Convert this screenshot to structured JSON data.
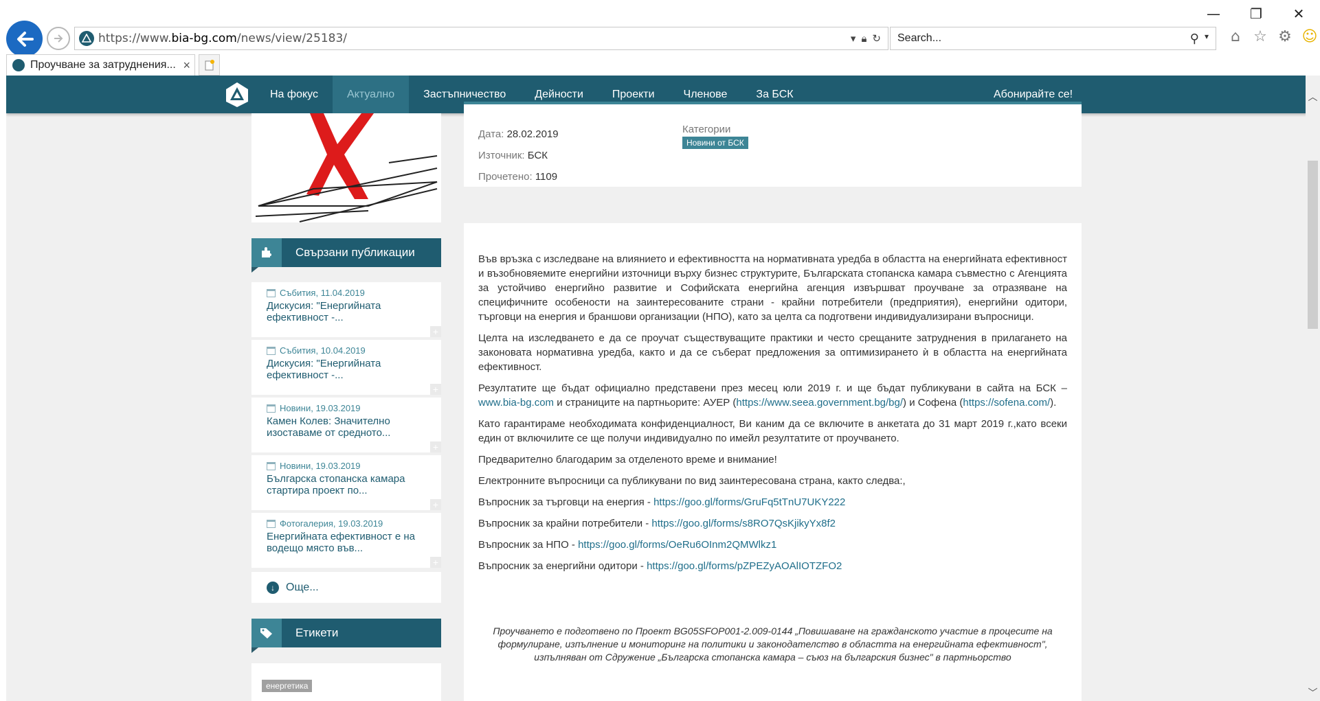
{
  "browser": {
    "url_prefix": "https://www.",
    "url_host": "bia-bg.com",
    "url_path": "/news/view/25183/",
    "search_placeholder": "Search...",
    "tab_title": "Проучване за затруднения...",
    "tab_close": "×",
    "win_minimize": "—",
    "win_restore": "❐",
    "win_close": "✕"
  },
  "nav": {
    "items": [
      "На фокус",
      "Актуално",
      "Застъпничество",
      "Дейности",
      "Проекти",
      "Членове",
      "За БСК"
    ],
    "active_index": 1,
    "subscribe": "Абонирайте се!"
  },
  "sidebar": {
    "related_title": "Свързани публикации",
    "publications": [
      {
        "meta": "Събития, 11.04.2019",
        "title": "Дискусия: \"Енергийната ефективност -..."
      },
      {
        "meta": "Събития, 10.04.2019",
        "title": "Дискусия: \"Енергийната ефективност -..."
      },
      {
        "meta": "Новини, 19.03.2019",
        "title": "Камен Колев: Значително изоставаме от средното..."
      },
      {
        "meta": "Новини, 19.03.2019",
        "title": "Българска стопанска камара стартира проект по..."
      },
      {
        "meta": "Фотогалерия, 19.03.2019",
        "title": "Енергийната ефективност е на водещо място във..."
      }
    ],
    "more": "Още...",
    "tags_title": "Етикети",
    "tags": [
      "енергетика"
    ]
  },
  "meta": {
    "date_label": "Дата:",
    "date": "28.02.2019",
    "source_label": "Източник:",
    "source": "БСК",
    "read_label": "Прочетено:",
    "read": "1109",
    "categories_label": "Категории",
    "category": "Новини от БСК"
  },
  "article": {
    "p1": "Във връзка с изследване на влиянието и ефективността на нормативната уредба в областта на енергийната ефективност и възобновяемите енергийни източници върху бизнес структурите, Българската стопанска камара съвместно с Агенцията за устойчиво енергийно развитие и Софийската енергийна агенция извършват проучване за отразяване на специфичните особености на заинтересованите страни - крайни потребители (предприятия), енергийни одитори, търговци на енергия и браншови организации (НПО), като за целта са подготвени индивидуализирани въпросници.",
    "p2": "Целта на изследването е да се проучат съществуващите практики и често срещаните затруднения в прилагането на законовата нормативна уредба, както и да се съберат предложения за оптимизирането ѝ в областта на енергийната ефективност.",
    "p3_a": "Резултатите ще бъдат официално представени през месец юли 2019 г. и ще бъдат публикувани в сайта на БСК – ",
    "p3_link1": "www.bia-bg.com",
    "p3_b": " и страниците на партньорите: АУЕР (",
    "p3_link2": "https://www.seea.government.bg/bg/",
    "p3_c": ") и Софена (",
    "p3_link3": "https://sofena.com/",
    "p3_d": ").",
    "p4": "Като гарантираме необходимата конфиденциалност, Ви каним да се включите в анкетата до 31 март 2019 г.,като всеки един от включилите се ще получи индивидуално по имейл резултатите от проучването.",
    "p5": "Предварително благодарим за отделеното време и внимание!",
    "p6": "Електронните въпросници са публикувани по вид заинтересована страна, както следва:,",
    "questionnaires": [
      {
        "label": "Въпросник за търговци на енергия - ",
        "link": "https://goo.gl/forms/GruFq5tTnU7UKY222"
      },
      {
        "label": "Въпросник за крайни потребители - ",
        "link": "https://goo.gl/forms/s8RO7QsKjikyYx8f2"
      },
      {
        "label": "Въпросник за НПО - ",
        "link": "https://goo.gl/forms/OeRu6OInm2QMWlkz1"
      },
      {
        "label": "Въпросник за енергийни одитори - ",
        "link": "https://goo.gl/forms/pZPEZyAOAlIOTZFO2"
      }
    ],
    "footnote": "Проучването е подготвено по Проект BG05SFOP001-2.009-0144 „Повишаване на гражданското участие в процесите на формулиране, изпълнение и мониторинг на политики и законодателство в областта на енергийната ефективност\", изпълняван от Сдружение „Българска стопанска камара – съюз на българския бизнес\" в партньорство"
  },
  "colors": {
    "brand": "#1f5c70",
    "accent": "#3d8596",
    "browser_back": "#1c6ac2"
  }
}
